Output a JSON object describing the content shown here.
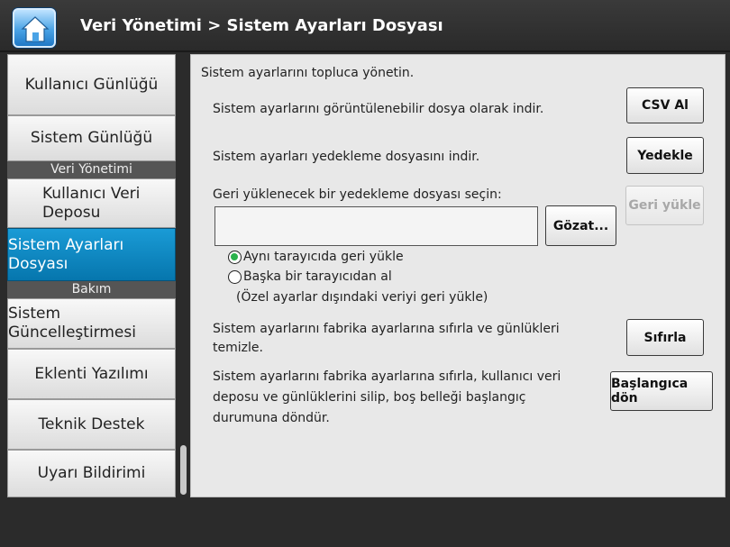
{
  "header": {
    "title": "Veri Yönetimi > Sistem Ayarları Dosyası"
  },
  "sidebar": {
    "items": [
      {
        "label": "Kullanıcı Günlüğü"
      },
      {
        "label": "Sistem Günlüğü"
      },
      {
        "label": "Kullanıcı Veri Deposu"
      },
      {
        "label": "Sistem Ayarları Dosyası"
      },
      {
        "label": "Sistem Güncelleştirmesi"
      },
      {
        "label": "Eklenti Yazılımı"
      },
      {
        "label": "Teknik Destek"
      },
      {
        "label": "Uyarı Bildirimi"
      }
    ],
    "sections": {
      "data_management": "Veri Yönetimi",
      "maintenance": "Bakım"
    }
  },
  "main": {
    "heading": "Sistem ayarlarını topluca yönetin.",
    "csv_text": "Sistem ayarlarını görüntülenebilir dosya olarak indir.",
    "csv_button": "CSV Al",
    "backup_text": "Sistem ayarları yedekleme dosyasını indir.",
    "backup_button": "Yedekle",
    "restore_label": "Geri yüklenecek bir yedekleme dosyası seçin:",
    "file_value": "",
    "browse_button": "Gözat...",
    "restore_button": "Geri yükle",
    "radio_same": "Aynı tarayıcıda geri yükle",
    "radio_other": "Başka bir tarayıcıdan al",
    "radio_other_note": "(Özel ayarlar dışındaki veriyi geri yükle)",
    "reset_text_line1": "Sistem ayarlarını fabrika ayarlarına sıfırla ve günlükleri",
    "reset_text_line2": "temizle.",
    "reset_button": "Sıfırla",
    "init_text_line1": "Sistem ayarlarını fabrika ayarlarına sıfırla, kullanıcı veri",
    "init_text_line2": "deposu ve günlüklerini silip, boş belleği başlangıç",
    "init_text_line3": "durumuna döndür.",
    "init_button": "Başlangıca dön"
  },
  "colors": {
    "accent": "#0a85c2",
    "radio_selected": "#2bb24c"
  }
}
